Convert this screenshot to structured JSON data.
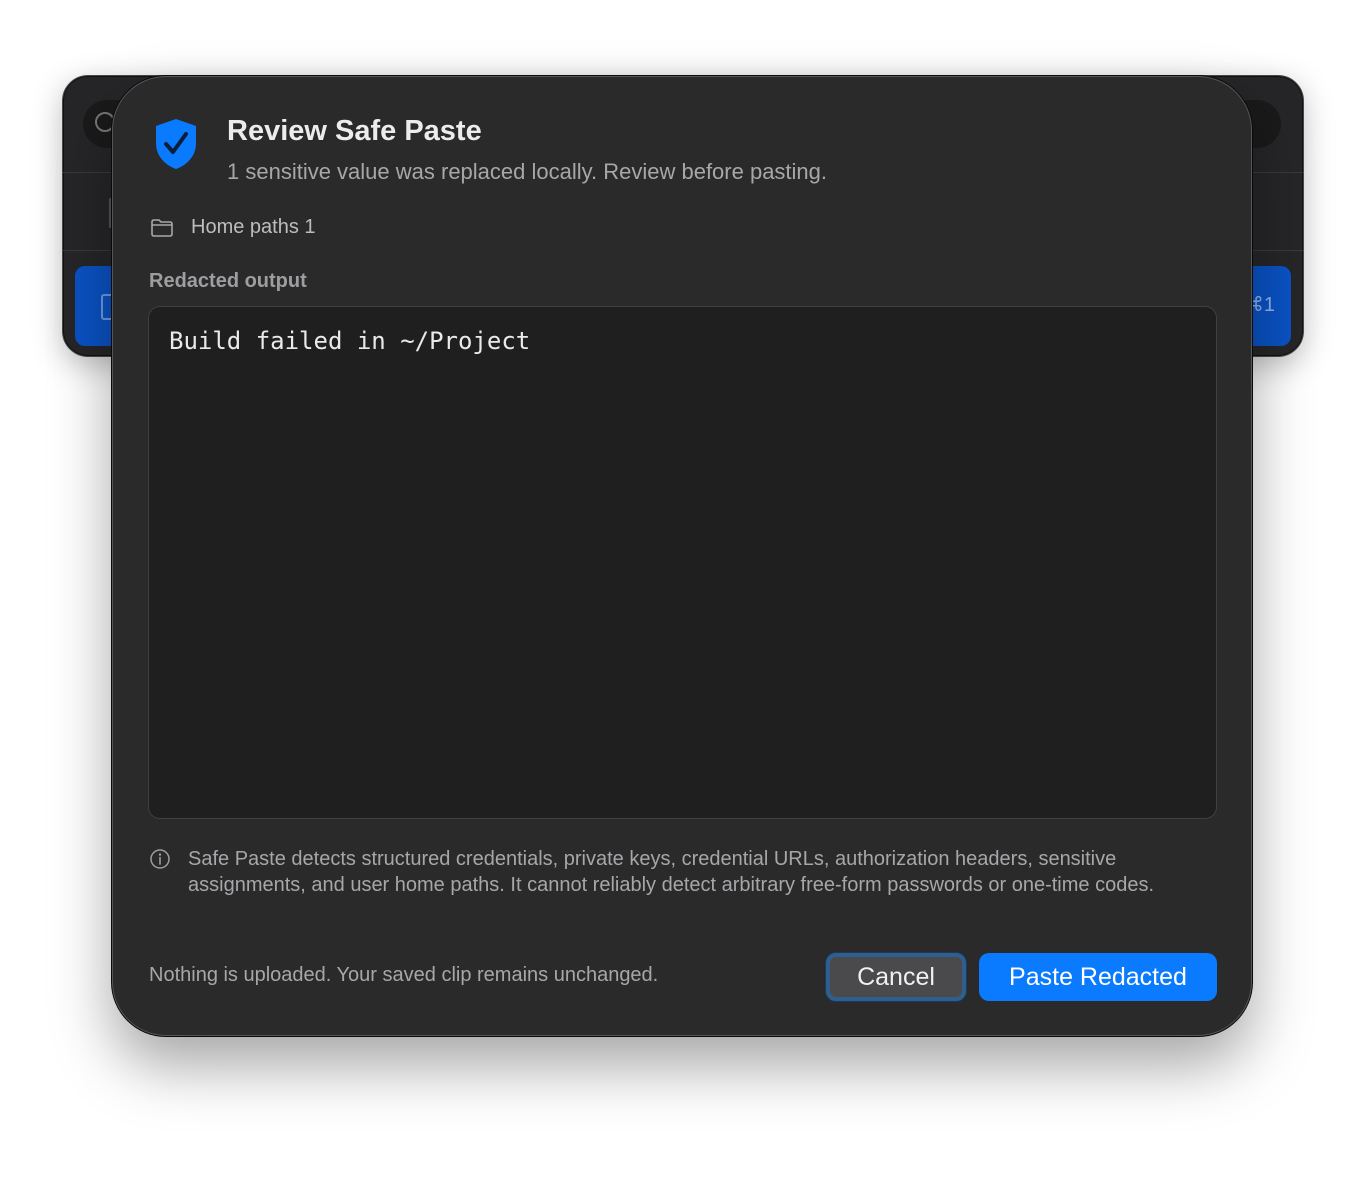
{
  "background_window": {
    "selected_row_shortcut": "⌘1"
  },
  "dialog": {
    "title": "Review Safe Paste",
    "subtitle": "1 sensitive value was replaced locally. Review before pasting.",
    "icon": "shield-checkmark-icon",
    "accent_color": "#0a7aff"
  },
  "categories": [
    {
      "icon": "folder-icon",
      "label": "Home paths 1"
    }
  ],
  "output": {
    "label": "Redacted output",
    "text": "Build failed in ~/Project"
  },
  "disclaimer": {
    "icon": "info-icon",
    "text": "Safe Paste detects structured credentials, private keys, credential URLs, authorization headers, sensitive assignments, and user home paths. It cannot reliably detect arbitrary free-form passwords or one-time codes."
  },
  "footer": {
    "note": "Nothing is uploaded. Your saved clip remains unchanged.",
    "cancel_label": "Cancel",
    "primary_label": "Paste Redacted"
  }
}
